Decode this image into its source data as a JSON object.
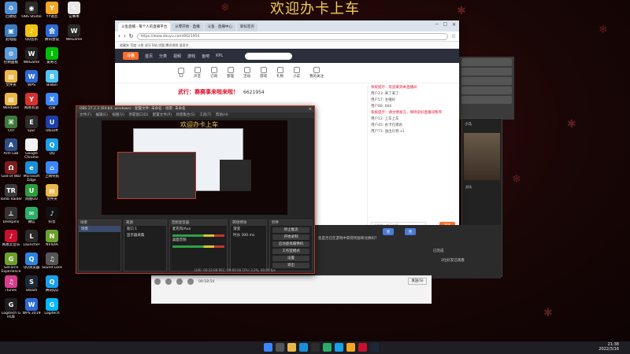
{
  "desktop": {
    "banner": "欢迎办卡上车",
    "icons_left": [
      {
        "label": "回收站",
        "color": "#4f8fd6",
        "glyph": "♻"
      },
      {
        "label": "此电脑",
        "color": "#3a7cc4",
        "glyph": "▣"
      },
      {
        "label": "控制面板",
        "color": "#5a9ad8",
        "glyph": "⚙"
      },
      {
        "label": "文件夹",
        "color": "#e8b84a",
        "glyph": "▤"
      },
      {
        "label": "Windows",
        "color": "#e8b84a",
        "glyph": "▤"
      },
      {
        "label": "Ctrl",
        "color": "#3c7a3c",
        "glyph": "⌘"
      },
      {
        "label": "Arm Lab",
        "color": "#2c4f86",
        "glyph": "A"
      },
      {
        "label": "God of War",
        "color": "#7c1e1e",
        "glyph": "Ω"
      },
      {
        "label": "Tomb Raider",
        "color": "#3a3a3a",
        "glyph": "TR"
      },
      {
        "label": "Deskpins",
        "color": "#333333",
        "glyph": "⊥"
      },
      {
        "label": "网易云音乐",
        "color": "#c8102e",
        "glyph": "♪"
      },
      {
        "label": "GeForce Experience",
        "color": "#6aa12a",
        "glyph": "G"
      },
      {
        "label": "iTunes",
        "color": "#d43f8d",
        "glyph": "♫"
      },
      {
        "label": "Logitech G HUB",
        "color": "#1f1f1f",
        "glyph": "G"
      }
    ],
    "icons_col2": [
      {
        "label": "OBS Studio",
        "color": "#2c2c2c",
        "glyph": "◉"
      },
      {
        "label": "QQ音乐",
        "color": "#f1c40f",
        "glyph": "♪"
      },
      {
        "label": "WeGame",
        "color": "#222222",
        "glyph": "W"
      },
      {
        "label": "WPS",
        "color": "#2c6bd6",
        "glyph": "W"
      },
      {
        "label": "网易有道",
        "color": "#d8322f",
        "glyph": "Y"
      },
      {
        "label": "Epic",
        "color": "#2d2d2d",
        "glyph": "E"
      },
      {
        "label": "Google Chrome",
        "color": "#f2f2f2",
        "glyph": "◎"
      },
      {
        "label": "Microsoft Edge",
        "color": "#1a8fd8",
        "glyph": "e"
      },
      {
        "label": "网易UU",
        "color": "#2c9c3c",
        "glyph": "U"
      },
      {
        "label": "微信",
        "color": "#2aae67",
        "glyph": "✉"
      },
      {
        "label": "Launcher",
        "color": "#2a2a2a",
        "glyph": "L"
      },
      {
        "label": "QQ浏览器",
        "color": "#2a85e0",
        "glyph": "Q"
      },
      {
        "label": "Steam",
        "color": "#1b2838",
        "glyph": "S"
      },
      {
        "label": "WPS 2019",
        "color": "#2c6bd6",
        "glyph": "W"
      }
    ],
    "icons_col3": [
      {
        "label": "YY语音",
        "color": "#f5a623",
        "glyph": "Y"
      },
      {
        "label": "腾讯会议",
        "color": "#2c6bd6",
        "glyph": "会"
      },
      {
        "label": "爱奇艺",
        "color": "#00be06",
        "glyph": "i"
      },
      {
        "label": "Bilibili",
        "color": "#4fc3f7",
        "glyph": "B"
      },
      {
        "label": "迅雷",
        "color": "#3a86ff",
        "glyph": "X"
      },
      {
        "label": "Ubisoft",
        "color": "#1d3fa8",
        "glyph": "U"
      },
      {
        "label": "QQ",
        "color": "#1aa0e8",
        "glyph": "Q"
      },
      {
        "label": "上网导航",
        "color": "#3a86ff",
        "glyph": "⌂"
      },
      {
        "label": "文件夹",
        "color": "#e8b84a",
        "glyph": "▤"
      },
      {
        "label": "抖音",
        "color": "#111111",
        "glyph": "♪"
      },
      {
        "label": "NVIDIA",
        "color": "#6aa12a",
        "glyph": "N"
      },
      {
        "label": "Sound Lock",
        "color": "#555555",
        "glyph": "♫"
      },
      {
        "label": "腾讯QQ",
        "color": "#1aa0e8",
        "glyph": "Q"
      },
      {
        "label": "Logitech",
        "color": "#00b8fc",
        "glyph": "G"
      }
    ],
    "icons_col4": [
      {
        "label": "记事本",
        "color": "#e8e8e8",
        "glyph": "✎"
      },
      {
        "label": "WeGame",
        "color": "#2a2a2a",
        "glyph": "W"
      }
    ]
  },
  "browser": {
    "tabs": [
      "斗鱼直播 · 每个人的直播平台",
      "从零开始 · 直播",
      "斗鱼 · 直播中心",
      "新标签页"
    ],
    "url": "https://www.douyu.com/6621954",
    "bookmarks": "收藏夹   百度   斗鱼   虎牙   B站   优酷   腾讯视频   爱奇艺",
    "site_logo": "斗鱼",
    "nav": [
      "首页",
      "分类",
      "视频",
      "游戏",
      "鱼吧",
      "KPL"
    ],
    "cats": [
      "12",
      "直播分区",
      "声音",
      "订阅",
      "管理",
      "活动",
      "游戏",
      "礼物",
      "小说",
      "我的关注",
      "电竞",
      "鱼吧"
    ],
    "room_title": "武行：赛赛事来啦来啦！",
    "room_number": "6621954",
    "chat_lines": [
      {
        "text": "系统提示：欢迎来到本直播间",
        "red": true
      },
      {
        "text": "用户23: 来了来了"
      },
      {
        "text": "用户57: 主播好"
      },
      {
        "text": "用户88: 666"
      },
      {
        "text": "系统提示：请文明发言，保持良好直播间秩序",
        "red": true
      },
      {
        "text": "用户12: 上车上车"
      },
      {
        "text": "用户45: 办卡在哪办"
      },
      {
        "text": "用户71: 送出礼物 x1"
      }
    ],
    "chat_placeholder": "这里输入聊天内容",
    "send_label": "发送"
  },
  "obs": {
    "title": "OBS 27.2.3 (64-bit, windows) - 配置文件: 未命名 - 场景: 未命名",
    "menu": "文件(F) 编辑(E) 视图(V) 停靠窗口(D) 配置文件(P) 场景集合(S) 工具(T) 帮助(H)",
    "preview_banner": "欢迎办卡上车",
    "docks": {
      "scenes": {
        "header": "场景",
        "items": [
          "场景"
        ]
      },
      "sources": {
        "header": "来源",
        "items": [
          "窗口 1",
          "显示器采集"
        ]
      },
      "mixer": {
        "header": "音频混音器",
        "items": [
          "麦克风/Aux",
          "桌面音频"
        ]
      },
      "transitions": {
        "header": "转场特效",
        "items": [
          "渐变",
          "时长 300 ms"
        ]
      },
      "controls": {
        "header": "控件",
        "items": [
          "停止推流",
          "开始录制",
          "启动虚拟摄像机",
          "工作室模式",
          "设置",
          "退出"
        ]
      }
    },
    "status": "LIVE: 00:12:08   REC: 00:00:00   CPU: 3.2%, 60.00 fps"
  },
  "right_panel": {
    "question": "您是否已在游戏中获得奖励和兑换码？",
    "note": "已完成",
    "like": "赞",
    "reply": "2位好友已观看"
  },
  "chat_app": {
    "meta": "00:18:54",
    "send": "发送(S)"
  },
  "right_float": {
    "title": "小马",
    "subtitle": "战场"
  },
  "taskbar": {
    "time": "21:38",
    "date": "2022/3/16"
  }
}
